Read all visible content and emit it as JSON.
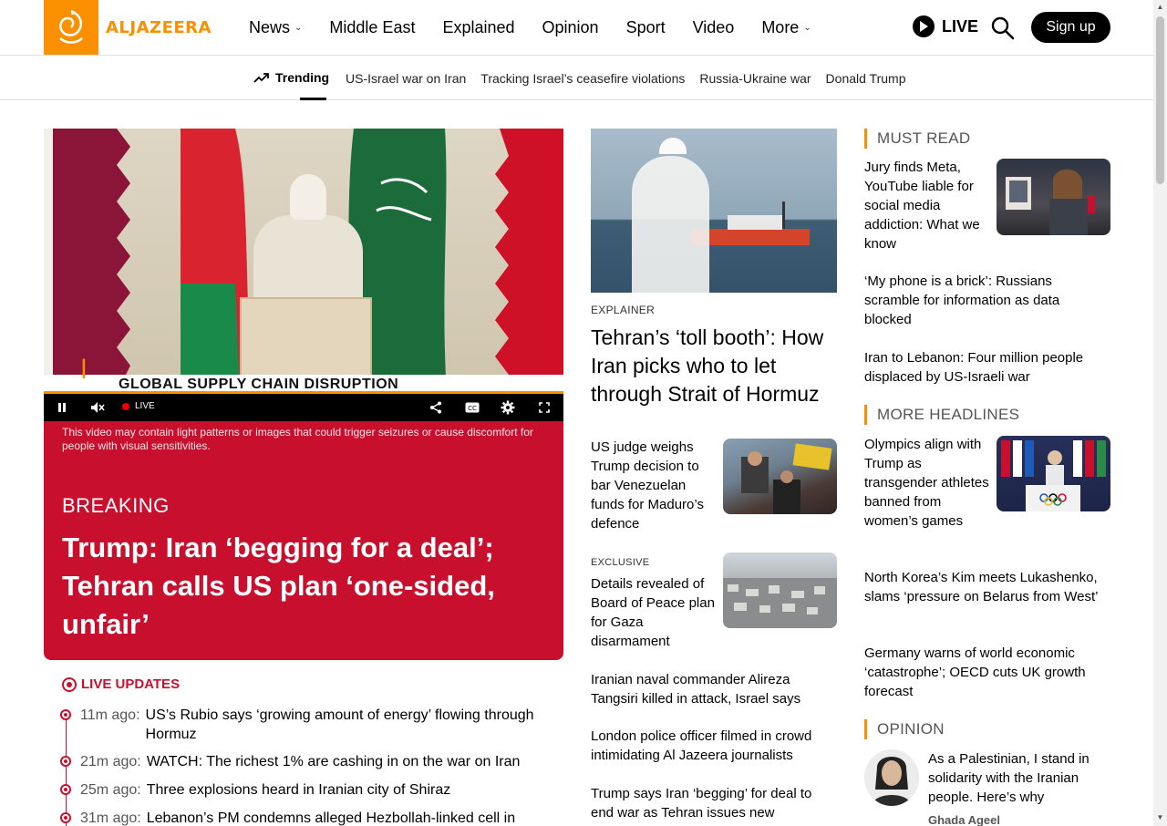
{
  "header": {
    "logo_text": "ALJAZEERA",
    "nav": [
      {
        "label": "News",
        "dropdown": true
      },
      {
        "label": "Middle East",
        "dropdown": false
      },
      {
        "label": "Explained",
        "dropdown": false
      },
      {
        "label": "Opinion",
        "dropdown": false
      },
      {
        "label": "Sport",
        "dropdown": false
      },
      {
        "label": "Video",
        "dropdown": false
      },
      {
        "label": "More",
        "dropdown": true
      }
    ],
    "live_label": "LIVE",
    "signup_label": "Sign up",
    "brand_color": "#fa9000"
  },
  "trending": {
    "label": "Trending",
    "links": [
      "US-Israel war on Iran",
      "Tracking Israel’s ceasefire violations",
      "Russia-Ukraine war",
      "Donald Trump"
    ]
  },
  "video": {
    "chyron": "GLOBAL SUPPLY CHAIN DISRUPTION",
    "live_label": "LIVE",
    "warning": "This video may contain light patterns or images that could trigger seizures or cause discomfort for people with visual sensitivities."
  },
  "breaking": {
    "label": "BREAKING",
    "title": "Trump: Iran ‘begging for a deal’; Tehran calls US plan ‘one-sided, unfair’",
    "color": "#c8102e"
  },
  "live_updates": {
    "title": "LIVE UPDATES",
    "items": [
      {
        "time": "11m ago:",
        "text": "US’s Rubio says ‘growing amount of energy’ flowing through Hormuz"
      },
      {
        "time": "21m ago:",
        "text": "WATCH: The richest 1% are cashing in on the war on Iran"
      },
      {
        "time": "25m ago:",
        "text": "Three explosions heard in Iranian city of Shiraz"
      },
      {
        "time": "31m ago:",
        "text": "Lebanon’s PM condemns alleged Hezbollah-linked cell in"
      }
    ]
  },
  "middle": {
    "lead_kicker": "EXPLAINER",
    "lead_title": "Tehran’s ‘toll booth’: How Iran picks who to let through Strait of Hormuz",
    "story1": "US judge weighs Trump decision to bar Venezuelan funds for Maduro’s defence",
    "story2_kicker": "EXCLUSIVE",
    "story2": "Details revealed of Board of Peace plan for Gaza disarmament",
    "story3": "Iranian naval commander Alireza Tangsiri killed in attack, Israel says",
    "story4": "London police officer filmed in crowd intimidating Al Jazeera journalists",
    "story5": "Trump says Iran ‘begging’ for deal to end war as Tehran issues new"
  },
  "right": {
    "must_read_label": "MUST READ",
    "must_read": [
      "Jury finds Meta, YouTube liable for social media addiction: What we know",
      "‘My phone is a brick’: Russians scramble for information as data blocked",
      "Iran to Lebanon: Four million people displaced by US-Israeli war"
    ],
    "more_headlines_label": "MORE HEADLINES",
    "more_headlines": [
      "Olympics align with Trump as transgender athletes banned from women’s games",
      "North Korea’s Kim meets Lukashenko, slams ‘pressure on Belarus from West’",
      "Germany warns of world economic ‘catastrophe’; OECD cuts UK growth forecast"
    ],
    "opinion_label": "OPINION",
    "opinion_title": "As a Palestinian, I stand in solidarity with the Iranian people. Here’s why",
    "opinion_author": "Ghada Ageel"
  }
}
